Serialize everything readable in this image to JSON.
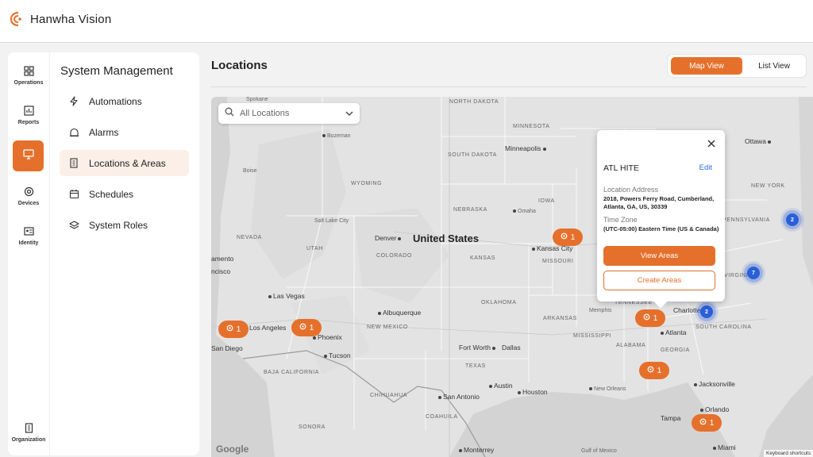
{
  "brand": {
    "name": "Hanwha Vision",
    "accent": "#e5702c"
  },
  "rail": {
    "items": [
      {
        "label": "Operations",
        "icon": "grid-icon"
      },
      {
        "label": "Reports",
        "icon": "chart-icon"
      },
      {
        "label": "",
        "icon": "monitor-icon"
      },
      {
        "label": "Devices",
        "icon": "camera-icon"
      },
      {
        "label": "Identity",
        "icon": "id-card-icon"
      },
      {
        "label": "Organization",
        "icon": "building-icon"
      }
    ]
  },
  "menu": {
    "title": "System Management",
    "items": [
      {
        "label": "Automations",
        "icon": "bolt-icon"
      },
      {
        "label": "Alarms",
        "icon": "alarm-icon"
      },
      {
        "label": "Locations & Areas",
        "icon": "building-icon",
        "active": true
      },
      {
        "label": "Schedules",
        "icon": "calendar-icon"
      },
      {
        "label": "System Roles",
        "icon": "layers-icon"
      }
    ]
  },
  "page": {
    "title": "Locations"
  },
  "view_toggle": {
    "map": "Map View",
    "list": "List View",
    "selected": "Map View"
  },
  "search": {
    "placeholder": "All Locations"
  },
  "map": {
    "country": "United States",
    "states": [
      "NORTH DAKOTA",
      "MINNESOTA",
      "SOUTH DAKOTA",
      "WYOMING",
      "NEBRASKA",
      "IOWA",
      "NEVADA",
      "UTAH",
      "COLORADO",
      "KANSAS",
      "MISSOURI",
      "OKLAHOMA",
      "ARKANSAS",
      "TENNESSEE",
      "NEW MEXICO",
      "TEXAS",
      "MISSISSIPPI",
      "ALABAMA",
      "GEORGIA",
      "SOUTH CAROLINA",
      "NEW YORK",
      "PENNSYLVANIA",
      "VIRGINIA",
      "BAJA CALIFORNIA",
      "CHIHUAHUA",
      "SONORA",
      "COAHUILA"
    ],
    "cities": [
      "Spokane",
      "Bozeman",
      "Boise",
      "Minneapolis",
      "Ottawa",
      "Omaha",
      "Salt Lake City",
      "Denver",
      "Kansas City",
      "Las Vegas",
      "Los Angeles",
      "Phoenix",
      "San Diego",
      "Albuquerque",
      "Tucson",
      "Memphis",
      "Charlotte",
      "Atlanta",
      "Fort Worth",
      "Dallas",
      "Austin",
      "Houston",
      "San Antonio",
      "New Orleans",
      "Jacksonville",
      "Orlando",
      "Tampa",
      "Miami",
      "Monterrey",
      "Gulf of Mexico"
    ],
    "left_edge_labels": [
      "amento",
      "ncisco"
    ],
    "pins": [
      {
        "count": "1"
      },
      {
        "count": "1"
      },
      {
        "count": "1"
      },
      {
        "count": "1"
      },
      {
        "count": "1"
      },
      {
        "count": "1"
      }
    ],
    "clusters": [
      {
        "count": "2"
      },
      {
        "count": "7"
      },
      {
        "count": "2"
      }
    ],
    "attribution": "Google",
    "keyboard": "Keyboard shortcuts"
  },
  "popup": {
    "name": "ATL HITE",
    "edit": "Edit",
    "address_label": "Location Address",
    "address": "2018, Powers Ferry Road, Cumberland, Atlanta, GA, US, 30339",
    "timezone_label": "Time Zone",
    "timezone": "(UTC-05:00) Eastern Time (US & Canada)",
    "view_button": "View Areas",
    "create_button": "Create Areas"
  }
}
